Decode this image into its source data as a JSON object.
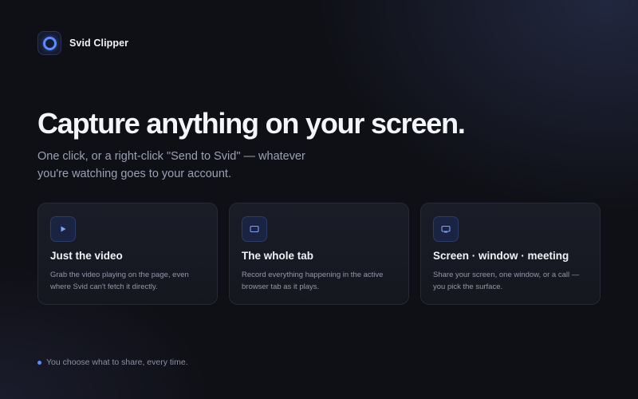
{
  "brand": {
    "name": "Svid Clipper",
    "logo_icon": "ring-logo-icon",
    "accent": "#5b8cff"
  },
  "hero": {
    "title": "Capture anything on your screen.",
    "subtitle": "One click, or a right-click \"Send to Svid\" — whatever you're watching goes to your account."
  },
  "cards": [
    {
      "icon": "play-icon",
      "title": "Just the video",
      "description": "Grab the video playing on the page, even where Svid can't fetch it directly."
    },
    {
      "icon": "tab-icon",
      "title": "The whole tab",
      "description": "Record everything happening in the active browser tab as it plays."
    },
    {
      "icon": "screen-icon",
      "title": "Screen · window · meeting",
      "description": "Share your screen, one window, or a call — you pick the surface."
    }
  ],
  "footer": {
    "note": "You choose what to share, every time."
  }
}
